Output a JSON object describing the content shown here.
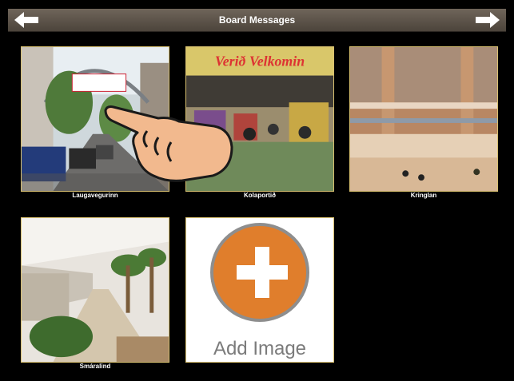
{
  "header": {
    "title": "Board Messages"
  },
  "nav": {
    "back_icon": "arrow-left-icon",
    "forward_icon": "arrow-right-icon"
  },
  "tiles": [
    {
      "caption": "Laugavegurinn"
    },
    {
      "caption": "Kolaportið",
      "sign": "Verið Velkomin"
    },
    {
      "caption": "Kringlan"
    },
    {
      "caption": "Smáralind"
    }
  ],
  "add_tile": {
    "label": "Add Image"
  },
  "overlay": {
    "icon": "pointing-hand-icon"
  },
  "colors": {
    "accent": "#e07e2c",
    "tile_border": "#d8c070",
    "bar": "#5e554b"
  }
}
